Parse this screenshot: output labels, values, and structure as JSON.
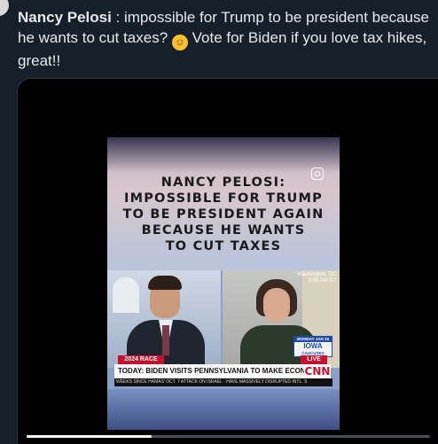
{
  "tweet": {
    "author": "Nancy Pelosi",
    "text_before_emoji": " : impossible for Trump to be president because he wants to cut taxes? ",
    "emoji": "rolling-on-floor-laughing",
    "text_after_emoji": " Vote for Biden if you love tax hikes, great!!"
  },
  "video": {
    "headline_lines": [
      "NANCY PELOSI:",
      "IMPOSSIBLE FOR TRUMP",
      "TO BE PRESIDENT AGAIN",
      "BECAUSE HE WANTS",
      "TO CUT TAXES"
    ],
    "location": "Washington, DC",
    "time": "9:09 AM ET",
    "iowa_badge": {
      "top": "MONDAY JAN 15",
      "title": "IOWA",
      "sub": "CAUCUSES"
    },
    "race_tag": "2024 RACE",
    "live_tag": "LIVE",
    "lower_third": "TODAY: BIDEN VISITS PENNSYLVANIA TO MAKE ECONOMIC PITCH",
    "network": "CNN",
    "ticker": "WEEKS SINCE HAMAS' OCT. 7 ATTACK ON ISRAEL · HAVE MASSIVELY DISRUPTED INTL. S",
    "progress_fraction": 0.31
  },
  "colors": {
    "background": "#15202b",
    "text": "#e7e9ea",
    "cnn_red": "#c8102e"
  }
}
